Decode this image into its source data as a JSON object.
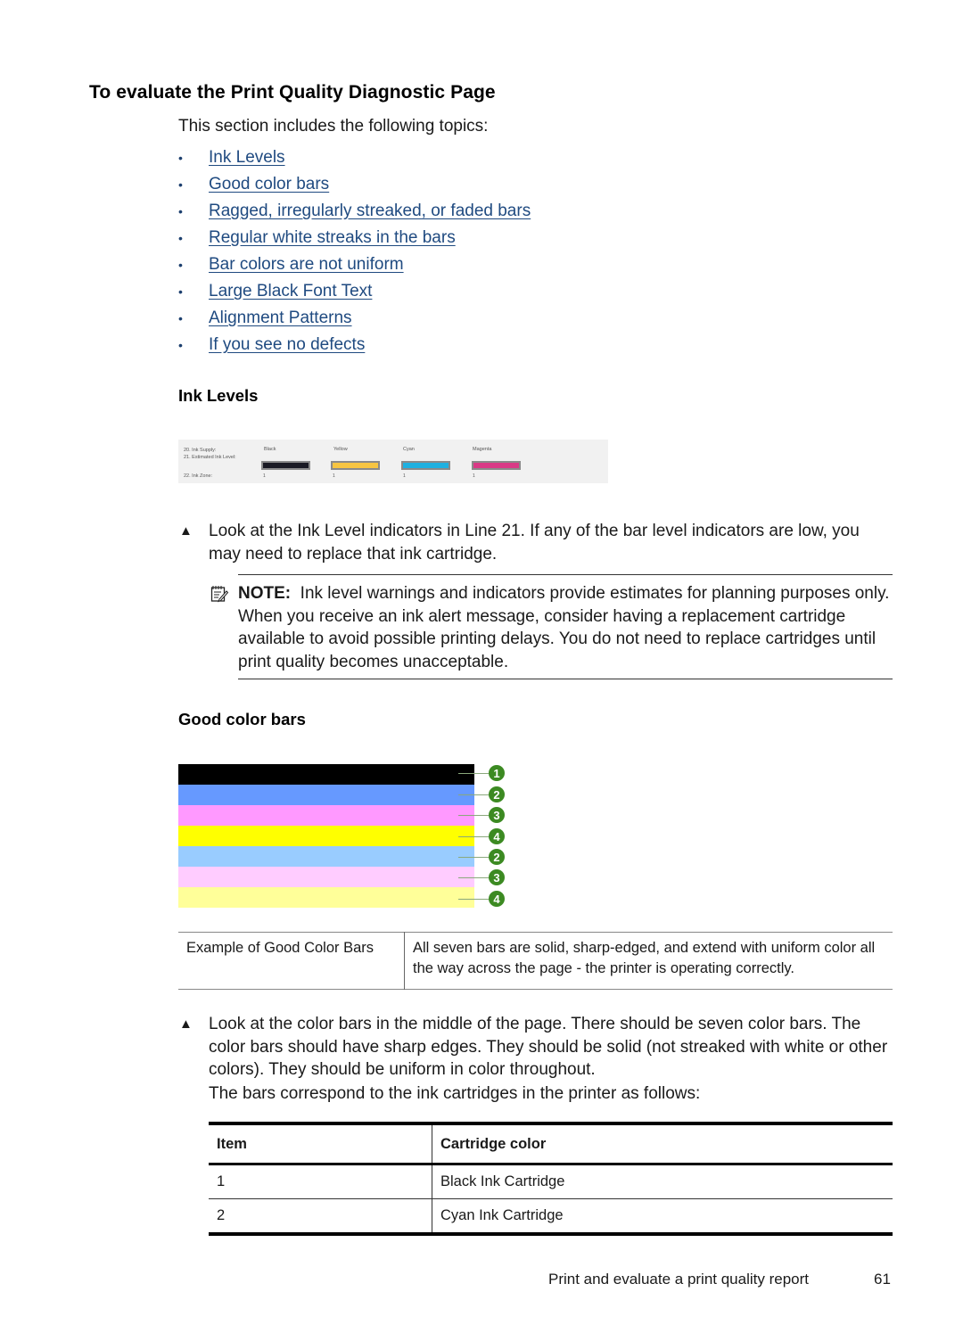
{
  "page": {
    "title": "To evaluate the Print Quality Diagnostic Page",
    "intro": "This section includes the following topics:",
    "toc": [
      "Ink Levels",
      "Good color bars",
      "Ragged, irregularly streaked, or faded bars",
      "Regular white streaks in the bars",
      "Bar colors are not uniform",
      "Large Black Font Text",
      "Alignment Patterns",
      "If you see no defects"
    ],
    "link_color": "#1f4a80"
  },
  "ink_levels": {
    "heading": "Ink Levels",
    "figure": {
      "row_labels": [
        "20. Ink Supply:",
        "21. Estimated Ink Level:",
        "22. Ink Zone:"
      ],
      "cartridges": [
        {
          "name": "Black",
          "color": "#1a1a24",
          "zone": "1"
        },
        {
          "name": "Yellow",
          "color": "#f7c542",
          "zone": "1"
        },
        {
          "name": "Cyan",
          "color": "#1fb0e0",
          "zone": "1"
        },
        {
          "name": "Magenta",
          "color": "#d93a86",
          "zone": "1"
        }
      ]
    },
    "instruction": "Look at the Ink Level indicators in Line 21. If any of the bar level indicators are low, you may need to replace that ink cartridge.",
    "note_label": "NOTE:",
    "note_text": "Ink level warnings and indicators provide estimates for planning purposes only. When you receive an ink alert message, consider having a replacement cartridge available to avoid possible printing delays. You do not need to replace cartridges until print quality becomes unacceptable."
  },
  "good_color_bars": {
    "heading": "Good color bars",
    "bars": [
      {
        "color": "#000000",
        "callout": "1"
      },
      {
        "color": "#6699ff",
        "callout": "2"
      },
      {
        "color": "#ff99ff",
        "callout": "3"
      },
      {
        "color": "#ffff00",
        "callout": "4"
      },
      {
        "color": "#99ccff",
        "callout": "2"
      },
      {
        "color": "#ffccff",
        "callout": "3"
      },
      {
        "color": "#ffff99",
        "callout": "4"
      }
    ],
    "example_table": {
      "label": "Example of Good Color Bars",
      "description": "All seven bars are solid, sharp-edged, and extend with uniform color all the way across the page - the printer is operating correctly."
    },
    "instruction": "Look at the color bars in the middle of the page. There should be seven color bars. The color bars should have sharp edges. They should be solid (not streaked with white or other colors). They should be uniform in color throughout.",
    "correspondence": "The bars correspond to the ink cartridges in the printer as follows:",
    "mapping_table": {
      "headers": [
        "Item",
        "Cartridge color"
      ],
      "rows": [
        [
          "1",
          "Black Ink Cartridge"
        ],
        [
          "2",
          "Cyan Ink Cartridge"
        ]
      ]
    }
  },
  "footer": {
    "section": "Print and evaluate a print quality report",
    "page_number": "61"
  }
}
